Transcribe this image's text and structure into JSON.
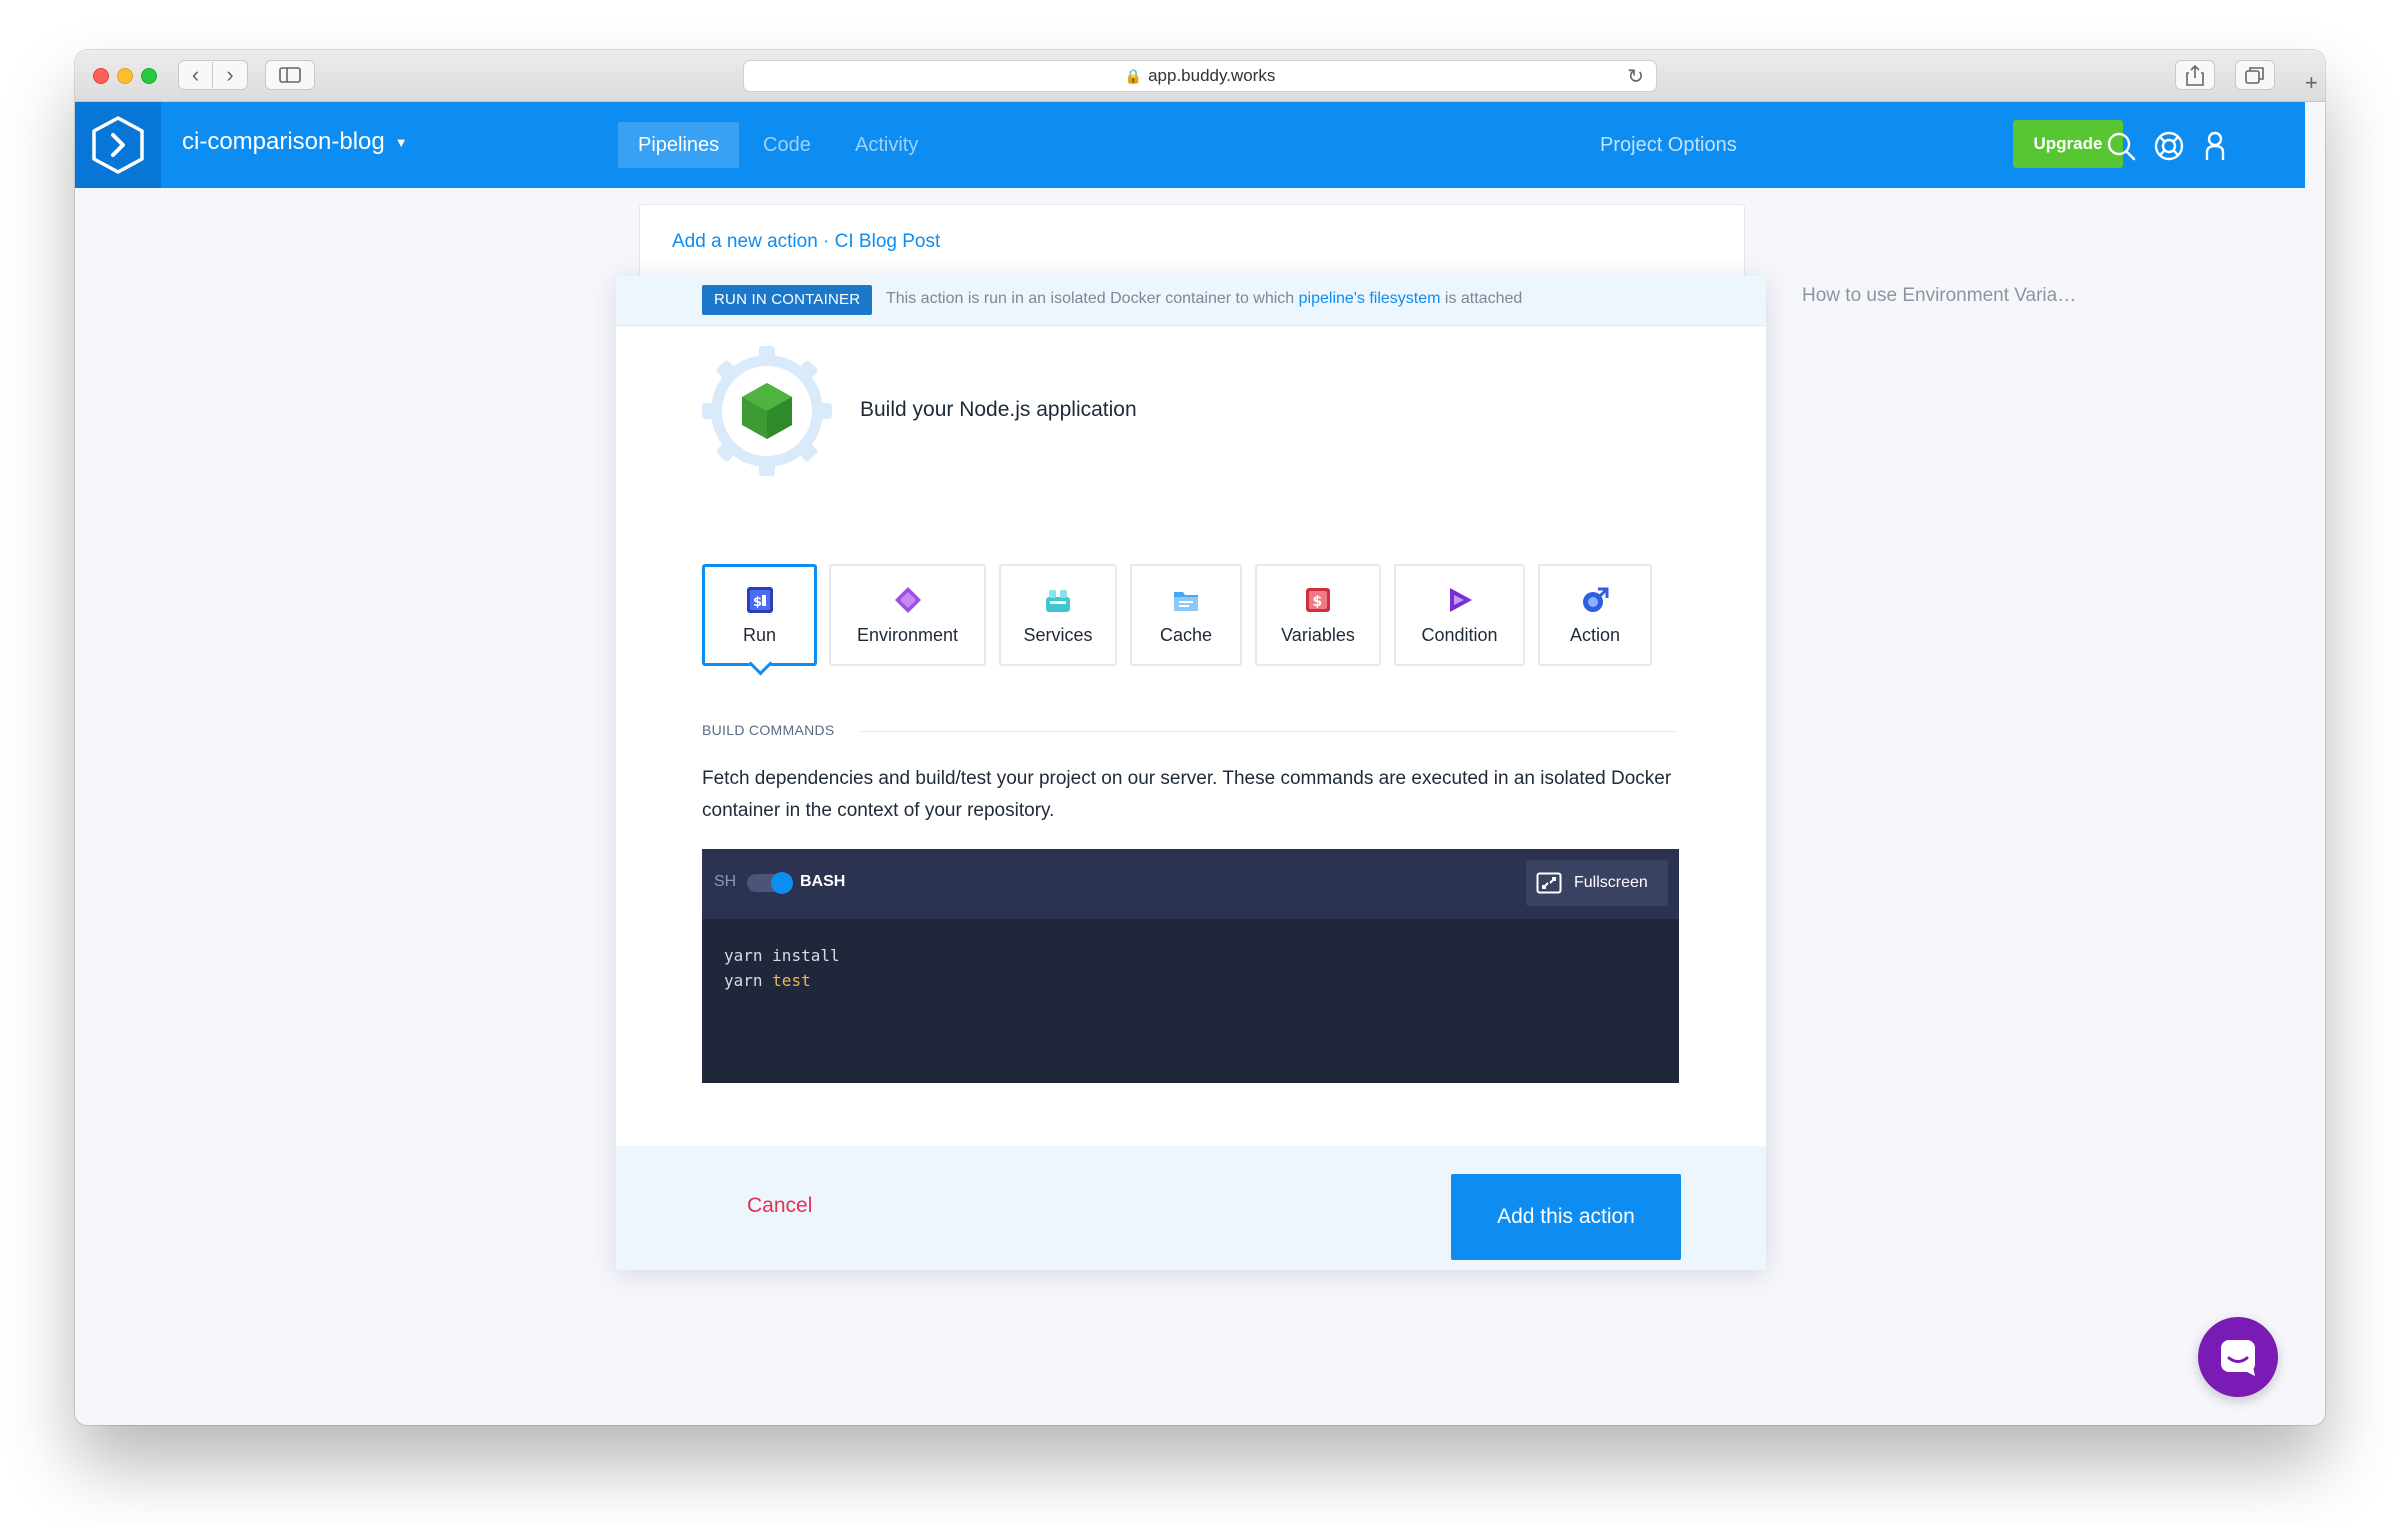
{
  "browser": {
    "url": "app.buddy.works"
  },
  "header": {
    "project_name": "ci-comparison-blog",
    "tabs": [
      {
        "label": "Pipelines",
        "active": true
      },
      {
        "label": "Code",
        "active": false
      },
      {
        "label": "Activity",
        "active": false
      }
    ],
    "project_options": "Project Options",
    "upgrade_label": "Upgrade",
    "colors": {
      "bar": "#0d8df1",
      "logo_bg": "#0876d6",
      "upgrade": "#58c532"
    }
  },
  "background_card": {
    "title": "Add a new action · CI Blog Post"
  },
  "side_link": "How to use Environment Varia…",
  "modal": {
    "badge": "RUN IN CONTAINER",
    "info_text_before": "This action is run in an isolated Docker container to which ",
    "info_link": "pipeline's filesystem",
    "info_text_after": " is attached",
    "action_title": "Build your Node.js application",
    "tabs": [
      {
        "label": "Run",
        "icon": "run-icon",
        "active": true
      },
      {
        "label": "Environment",
        "icon": "environment-icon",
        "active": false
      },
      {
        "label": "Services",
        "icon": "services-icon",
        "active": false
      },
      {
        "label": "Cache",
        "icon": "cache-icon",
        "active": false
      },
      {
        "label": "Variables",
        "icon": "variables-icon",
        "active": false
      },
      {
        "label": "Condition",
        "icon": "condition-icon",
        "active": false
      },
      {
        "label": "Action",
        "icon": "action-icon",
        "active": false
      }
    ],
    "section_label": "BUILD COMMANDS",
    "description": "Fetch dependencies and build/test your project on our server. These commands are executed in an isolated Docker container in the context of your repository.",
    "editor": {
      "shell_left": "SH",
      "shell_right": "BASH",
      "shell_selected": "BASH",
      "fullscreen_label": "Fullscreen",
      "lines": [
        {
          "cmd": "yarn",
          "arg": "install",
          "arg_highlight": false
        },
        {
          "cmd": "yarn",
          "arg": "test",
          "arg_highlight": true
        }
      ]
    },
    "footer": {
      "cancel_label": "Cancel",
      "add_label": "Add this action"
    }
  }
}
